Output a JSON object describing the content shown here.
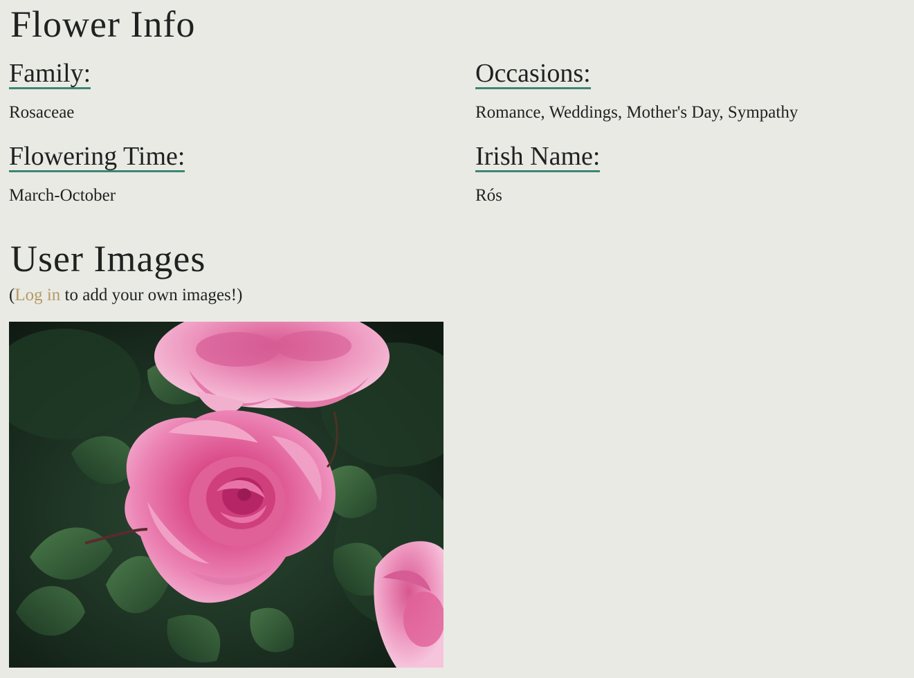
{
  "page": {
    "flower_info_heading": "Flower Info",
    "user_images_heading": "User Images"
  },
  "info": {
    "family": {
      "label": "Family:",
      "value": "Rosaceae"
    },
    "occasions": {
      "label": "Occasions:",
      "value": "Romance, Weddings, Mother's Day, Sympathy"
    },
    "flowering_time": {
      "label": "Flowering Time:",
      "value": "March-October"
    },
    "irish_name": {
      "label": "Irish Name:",
      "value": "Rós"
    }
  },
  "user_images": {
    "prefix": "(",
    "login_link_text": "Log in",
    "suffix": " to add your own images!)",
    "images": [
      {
        "icon": "pink-rose-photo"
      }
    ]
  },
  "colors": {
    "background": "#e9eae4",
    "text": "#1f2220",
    "label_underline": "#3d8574",
    "link": "#b69a64"
  }
}
